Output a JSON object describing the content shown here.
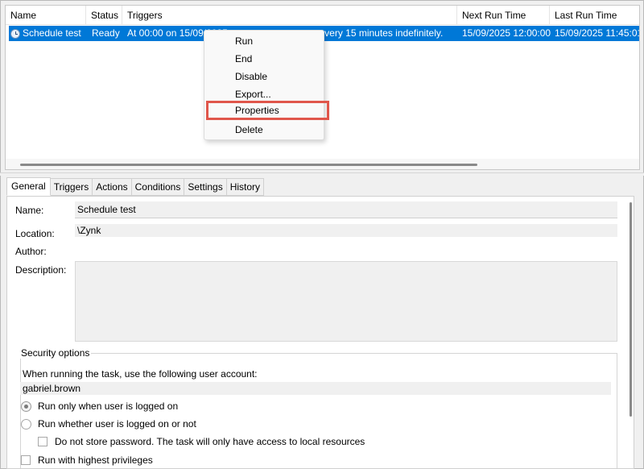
{
  "columns": {
    "name": "Name",
    "status": "Status",
    "triggers": "Triggers",
    "next_run": "Next Run Time",
    "last_run": "Last Run Time"
  },
  "task": {
    "name": "Schedule test",
    "status": "Ready",
    "triggers_start": "At 00:00 on 15/09/2025",
    "triggers_end": "every 15 minutes indefinitely.",
    "next_run": "15/09/2025 12:00:00",
    "last_run": "15/09/2025 11:45:01",
    "icon": "task-clock-icon"
  },
  "context_menu": {
    "items": [
      "Run",
      "End",
      "Disable",
      "Export...",
      "Properties",
      "Delete"
    ],
    "highlighted": "Properties",
    "highlight_color": "#e0564b"
  },
  "tabs": [
    "General",
    "Triggers",
    "Actions",
    "Conditions",
    "Settings",
    "History"
  ],
  "active_tab": "General",
  "general": {
    "name_label": "Name:",
    "name_value": "Schedule test",
    "location_label": "Location:",
    "location_value": "\\Zynk",
    "author_label": "Author:",
    "author_value": "",
    "description_label": "Description:",
    "description_value": ""
  },
  "security": {
    "title": "Security options",
    "account_prompt": "When running the task, use the following user account:",
    "account": "gabriel.brown",
    "radio_logged_on": "Run only when user is logged on",
    "radio_whether": "Run whether user is logged on or not",
    "no_store_password": "Do not store password.  The task will only have access to local resources",
    "highest_privileges": "Run with highest privileges"
  },
  "colors": {
    "selection": "#0078d7"
  }
}
